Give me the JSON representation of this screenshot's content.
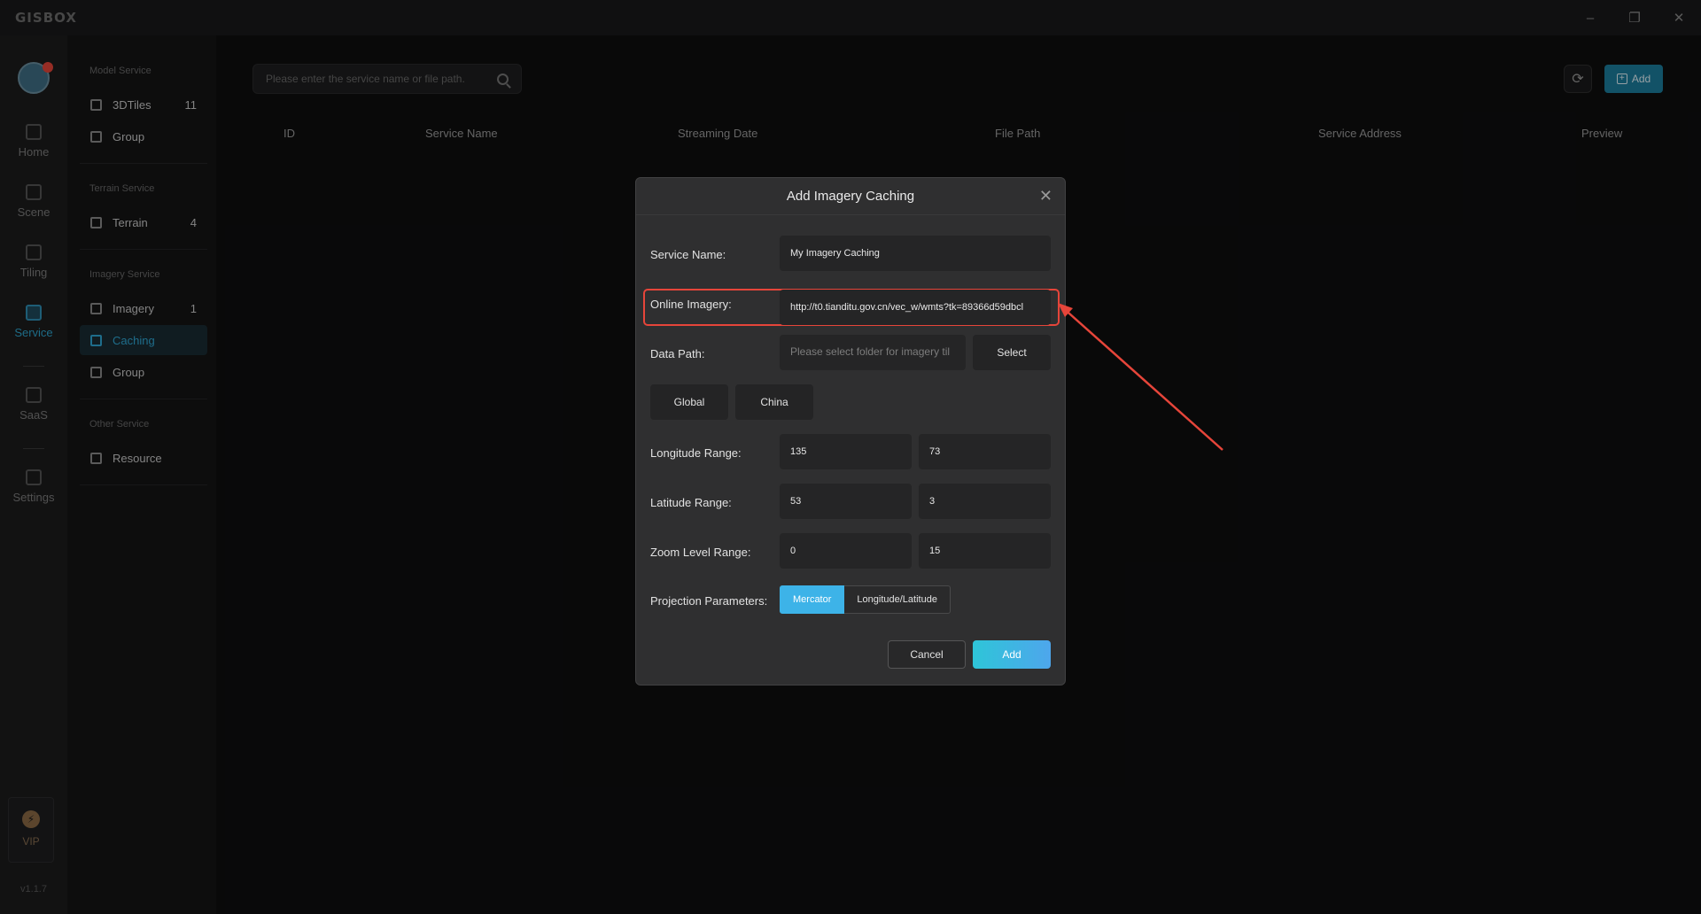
{
  "app": {
    "logo": "GISBOX",
    "version": "v1.1.7"
  },
  "window": {
    "minimize": "–",
    "restore": "❐",
    "close": "✕"
  },
  "rail": {
    "items": [
      {
        "label": "Home",
        "icon": "home-icon"
      },
      {
        "label": "Scene",
        "icon": "cube-icon"
      },
      {
        "label": "Tiling",
        "icon": "tiling-icon"
      },
      {
        "label": "Service",
        "icon": "service-icon"
      },
      {
        "label": "SaaS",
        "icon": "lock-icon"
      },
      {
        "label": "Settings",
        "icon": "gear-icon"
      }
    ],
    "vip": "VIP",
    "vip_symbol": "⚡"
  },
  "subnav": {
    "model_service": {
      "title": "Model Service",
      "items": [
        {
          "label": "3DTiles",
          "count": "11"
        },
        {
          "label": "Group",
          "count": ""
        }
      ]
    },
    "terrain_service": {
      "title": "Terrain Service",
      "items": [
        {
          "label": "Terrain",
          "count": "4"
        }
      ]
    },
    "imagery_service": {
      "title": "Imagery Service",
      "items": [
        {
          "label": "Imagery",
          "count": "1"
        },
        {
          "label": "Caching",
          "count": ""
        },
        {
          "label": "Group",
          "count": ""
        }
      ]
    },
    "other_service": {
      "title": "Other Service",
      "items": [
        {
          "label": "Resource",
          "count": ""
        }
      ]
    }
  },
  "toolbar": {
    "search_placeholder": "Please enter the service name or file path.",
    "refresh_symbol": "⟳",
    "add_label": "Add",
    "add_symbol": "+"
  },
  "table": {
    "columns": [
      "ID",
      "Service Name",
      "Streaming Date",
      "File Path",
      "Service Address",
      "Preview"
    ]
  },
  "modal": {
    "title": "Add Imagery Caching",
    "close_symbol": "✕",
    "service_name": {
      "label": "Service Name:",
      "value": "My Imagery Caching"
    },
    "online_imagery": {
      "label": "Online Imagery:",
      "value": "http://t0.tianditu.gov.cn/vec_w/wmts?tk=89366d59dbcl"
    },
    "data_path": {
      "label": "Data Path:",
      "placeholder": "Please select folder for imagery til",
      "select_label": "Select"
    },
    "presets": {
      "global": "Global",
      "china": "China"
    },
    "longitude": {
      "label": "Longitude Range:",
      "min": "135",
      "max": "73"
    },
    "latitude": {
      "label": "Latitude Range:",
      "min": "53",
      "max": "3"
    },
    "zoom": {
      "label": "Zoom Level Range:",
      "min": "0",
      "max": "15"
    },
    "projection": {
      "label": "Projection Parameters:",
      "options": [
        "Mercator",
        "Longitude/Latitude"
      ],
      "selected": "Mercator"
    },
    "cancel_label": "Cancel",
    "add_label": "Add"
  },
  "colors": {
    "accent": "#3db3e8",
    "highlight": "#e6453a",
    "background": "#0e0e0f"
  }
}
